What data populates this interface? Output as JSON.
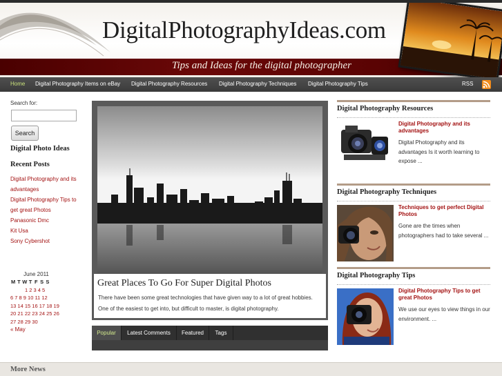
{
  "header": {
    "site_title": "DigitalPhotographyIdeas.com",
    "tagline": "Tips and Ideas for the digital photographer"
  },
  "nav": {
    "items": [
      {
        "label": "Home"
      },
      {
        "label": "Digital Photography Items on eBay"
      },
      {
        "label": "Digital Photography Resources"
      },
      {
        "label": "Digital Photography Techniques"
      },
      {
        "label": "Digital Photography Tips"
      }
    ],
    "rss_label": "RSS"
  },
  "sidebar": {
    "search_label": "Search for:",
    "search_value": "",
    "search_button": "Search",
    "ideas_heading": "Digital Photo Ideas",
    "recent_heading": "Recent Posts",
    "recent_posts": [
      "Digital Photography and its advantages",
      "Digital Photography Tips to get great Photos",
      "Panasonic Dmc",
      "Kit Usa",
      "Sony Cybershot"
    ],
    "calendar": {
      "caption": "June 2011",
      "weekdays": [
        "M",
        "T",
        "W",
        "T",
        "F",
        "S",
        "S"
      ],
      "rows": [
        "1 2 3 4 5",
        "6 7 8 9 10 11 12",
        "13 14 15 16 17 18 19",
        "20 21 22 23 24 25 26",
        "27 28 29 30"
      ],
      "prev": "« May"
    }
  },
  "featured": {
    "title": "Great Places To Go For Super Digital Photos",
    "text_1": "There have been some great technologies that have given way to a lot of great hobbies.",
    "text_2": "One of the easiest to get into, but difficult to master, is digital photography."
  },
  "tabs": [
    "Popular",
    "Latest Comments",
    "Featured",
    "Tags"
  ],
  "right": {
    "sections": [
      {
        "heading": "Digital Photography Resources",
        "link": "Digital Photography and its advantages",
        "text": "Digital Photography and its advantages Is it worth learning to expose ..."
      },
      {
        "heading": "Digital Photography Techniques",
        "link": "Techniques to get perfect Digital Photos",
        "text": "Gone are the times when photographers had to take several ..."
      },
      {
        "heading": "Digital Photography Tips",
        "link": "Digital Photography Tips to get great Photos",
        "text": "We use our eyes to view things in our environment. ..."
      }
    ]
  },
  "footer": {
    "title": "More News"
  }
}
